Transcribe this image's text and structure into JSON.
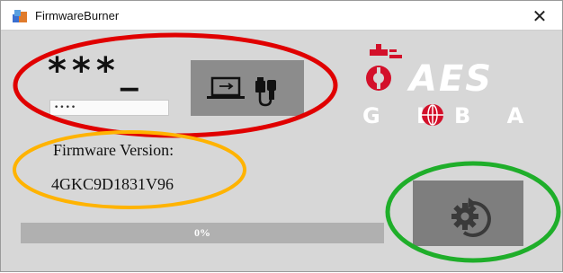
{
  "window": {
    "title": "FirmwareBurner",
    "close_label": "✕"
  },
  "password": {
    "masked_display": "***_",
    "input_value": "••••"
  },
  "logo": {
    "brand_top": "AES",
    "brand_bottom_left": "G L",
    "brand_bottom_right": "B A L"
  },
  "firmware": {
    "label": "Firmware Version:",
    "value": "4GKC9D1831V96"
  },
  "progress": {
    "value_fraction": 0,
    "text": "0%"
  },
  "buttons": {
    "usb_icon": "laptop-usb-icon",
    "burn_icon": "gear-refresh-icon"
  },
  "colors": {
    "brand_red": "#d3102a",
    "annotation_red": "#e00000",
    "annotation_orange": "#ffb300",
    "annotation_green": "#1fae2a"
  }
}
